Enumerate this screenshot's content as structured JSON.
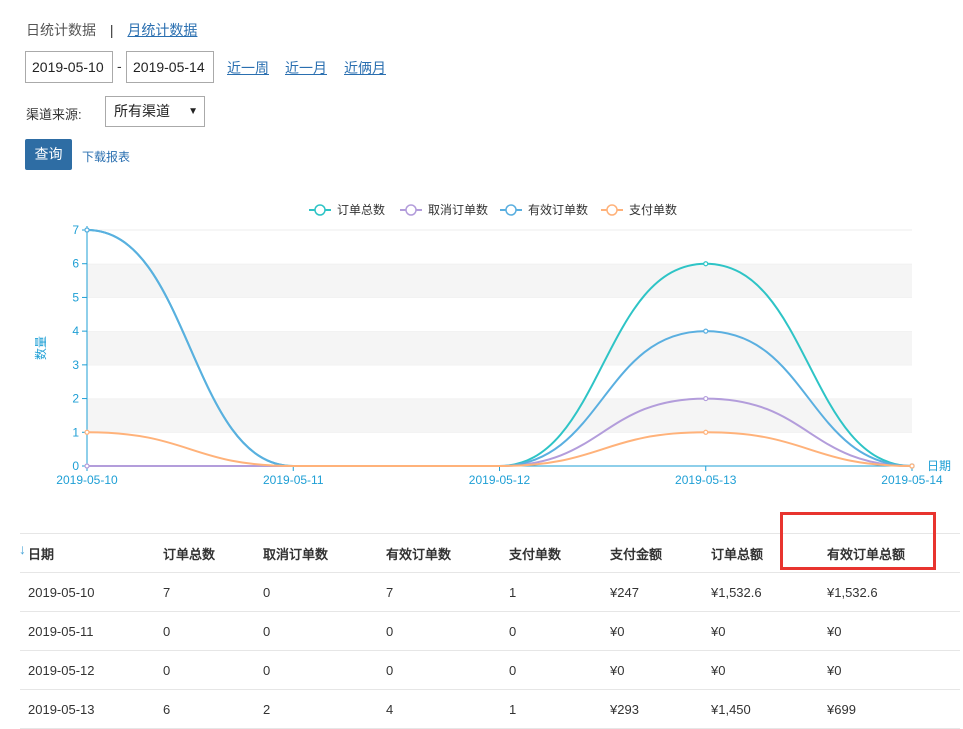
{
  "tabs": {
    "daily": "日统计数据",
    "separator": "|",
    "monthly": "月统计数据"
  },
  "filters": {
    "start_date": "2019-05-10",
    "dash": "-",
    "end_date": "2019-05-14",
    "quick_week": "近一周",
    "quick_month": "近一月",
    "quick_two_months": "近俩月",
    "channel_label": "渠道来源:",
    "channel_value": "所有渠道",
    "query_button": "查询",
    "download_link": "下载报表"
  },
  "chart_data": {
    "type": "line",
    "categories": [
      "2019-05-10",
      "2019-05-11",
      "2019-05-12",
      "2019-05-13",
      "2019-05-14"
    ],
    "series": [
      {
        "name": "订单总数",
        "color": "#2ec4c6",
        "values": [
          7,
          0,
          0,
          6,
          0
        ]
      },
      {
        "name": "取消订单数",
        "color": "#b39ddb",
        "values": [
          0,
          0,
          0,
          2,
          0
        ]
      },
      {
        "name": "有效订单数",
        "color": "#5aafe0",
        "values": [
          7,
          0,
          0,
          4,
          0
        ]
      },
      {
        "name": "支付单数",
        "color": "#ffb27a",
        "values": [
          1,
          0,
          0,
          1,
          0
        ]
      }
    ],
    "ylabel": "数量",
    "xlabel": "日期",
    "ylim": [
      0,
      7
    ],
    "yticks": [
      "0",
      "1",
      "2",
      "3",
      "4",
      "5",
      "6",
      "7"
    ],
    "legend_position": "top-center",
    "axis_color": "#1e9fd5",
    "smooth": true
  },
  "table": {
    "headers": [
      "日期",
      "订单总数",
      "取消订单数",
      "有效订单数",
      "支付单数",
      "支付金额",
      "订单总额",
      "有效订单总额"
    ],
    "rows": [
      [
        "2019-05-10",
        "7",
        "0",
        "7",
        "1",
        "¥247",
        "¥1,532.6",
        "¥1,532.6"
      ],
      [
        "2019-05-11",
        "0",
        "0",
        "0",
        "0",
        "¥0",
        "¥0",
        "¥0"
      ],
      [
        "2019-05-12",
        "0",
        "0",
        "0",
        "0",
        "¥0",
        "¥0",
        "¥0"
      ],
      [
        "2019-05-13",
        "6",
        "2",
        "4",
        "1",
        "¥293",
        "¥1,450",
        "¥699"
      ]
    ],
    "sort_icon": "sort-arrow-down-icon",
    "highlight_color": "#e8342f"
  }
}
